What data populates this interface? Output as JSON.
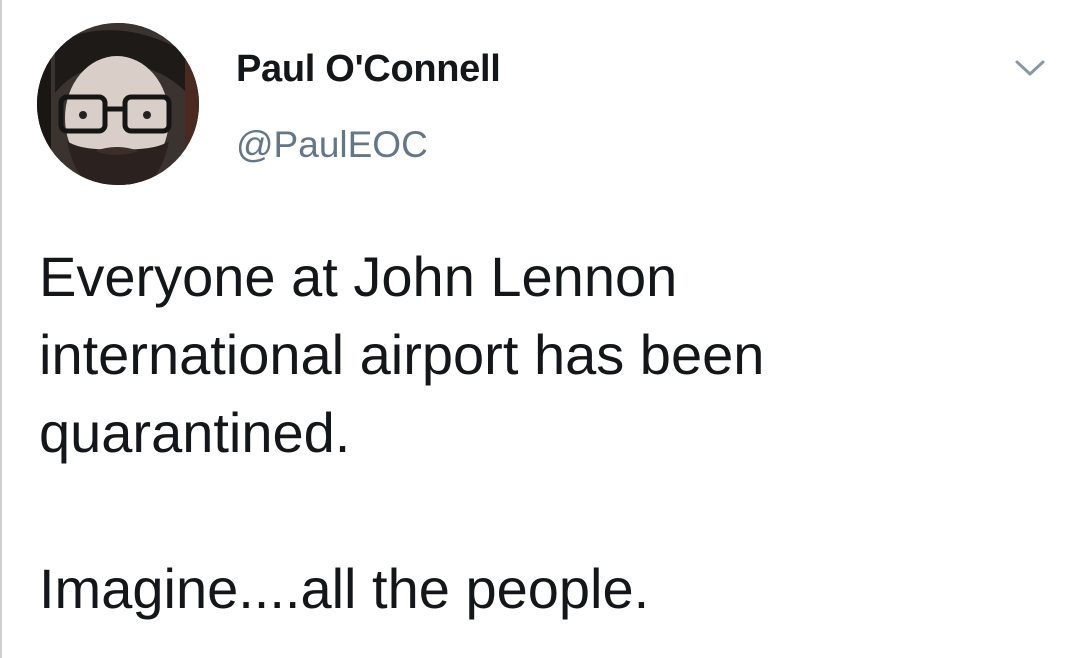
{
  "tweet": {
    "author": {
      "display_name": "Paul O'Connell",
      "handle": "@PaulEOC",
      "avatar_icon": "user-avatar-photo"
    },
    "menu_icon": "chevron-down-icon",
    "text_lines": [
      "Everyone at John Lennon",
      "international airport has been",
      "quarantined."
    ],
    "punchline": "Imagine....all the people."
  },
  "colors": {
    "text_primary": "#14171a",
    "text_secondary": "#657786",
    "chevron": "#8899a6",
    "background": "#ffffff"
  }
}
